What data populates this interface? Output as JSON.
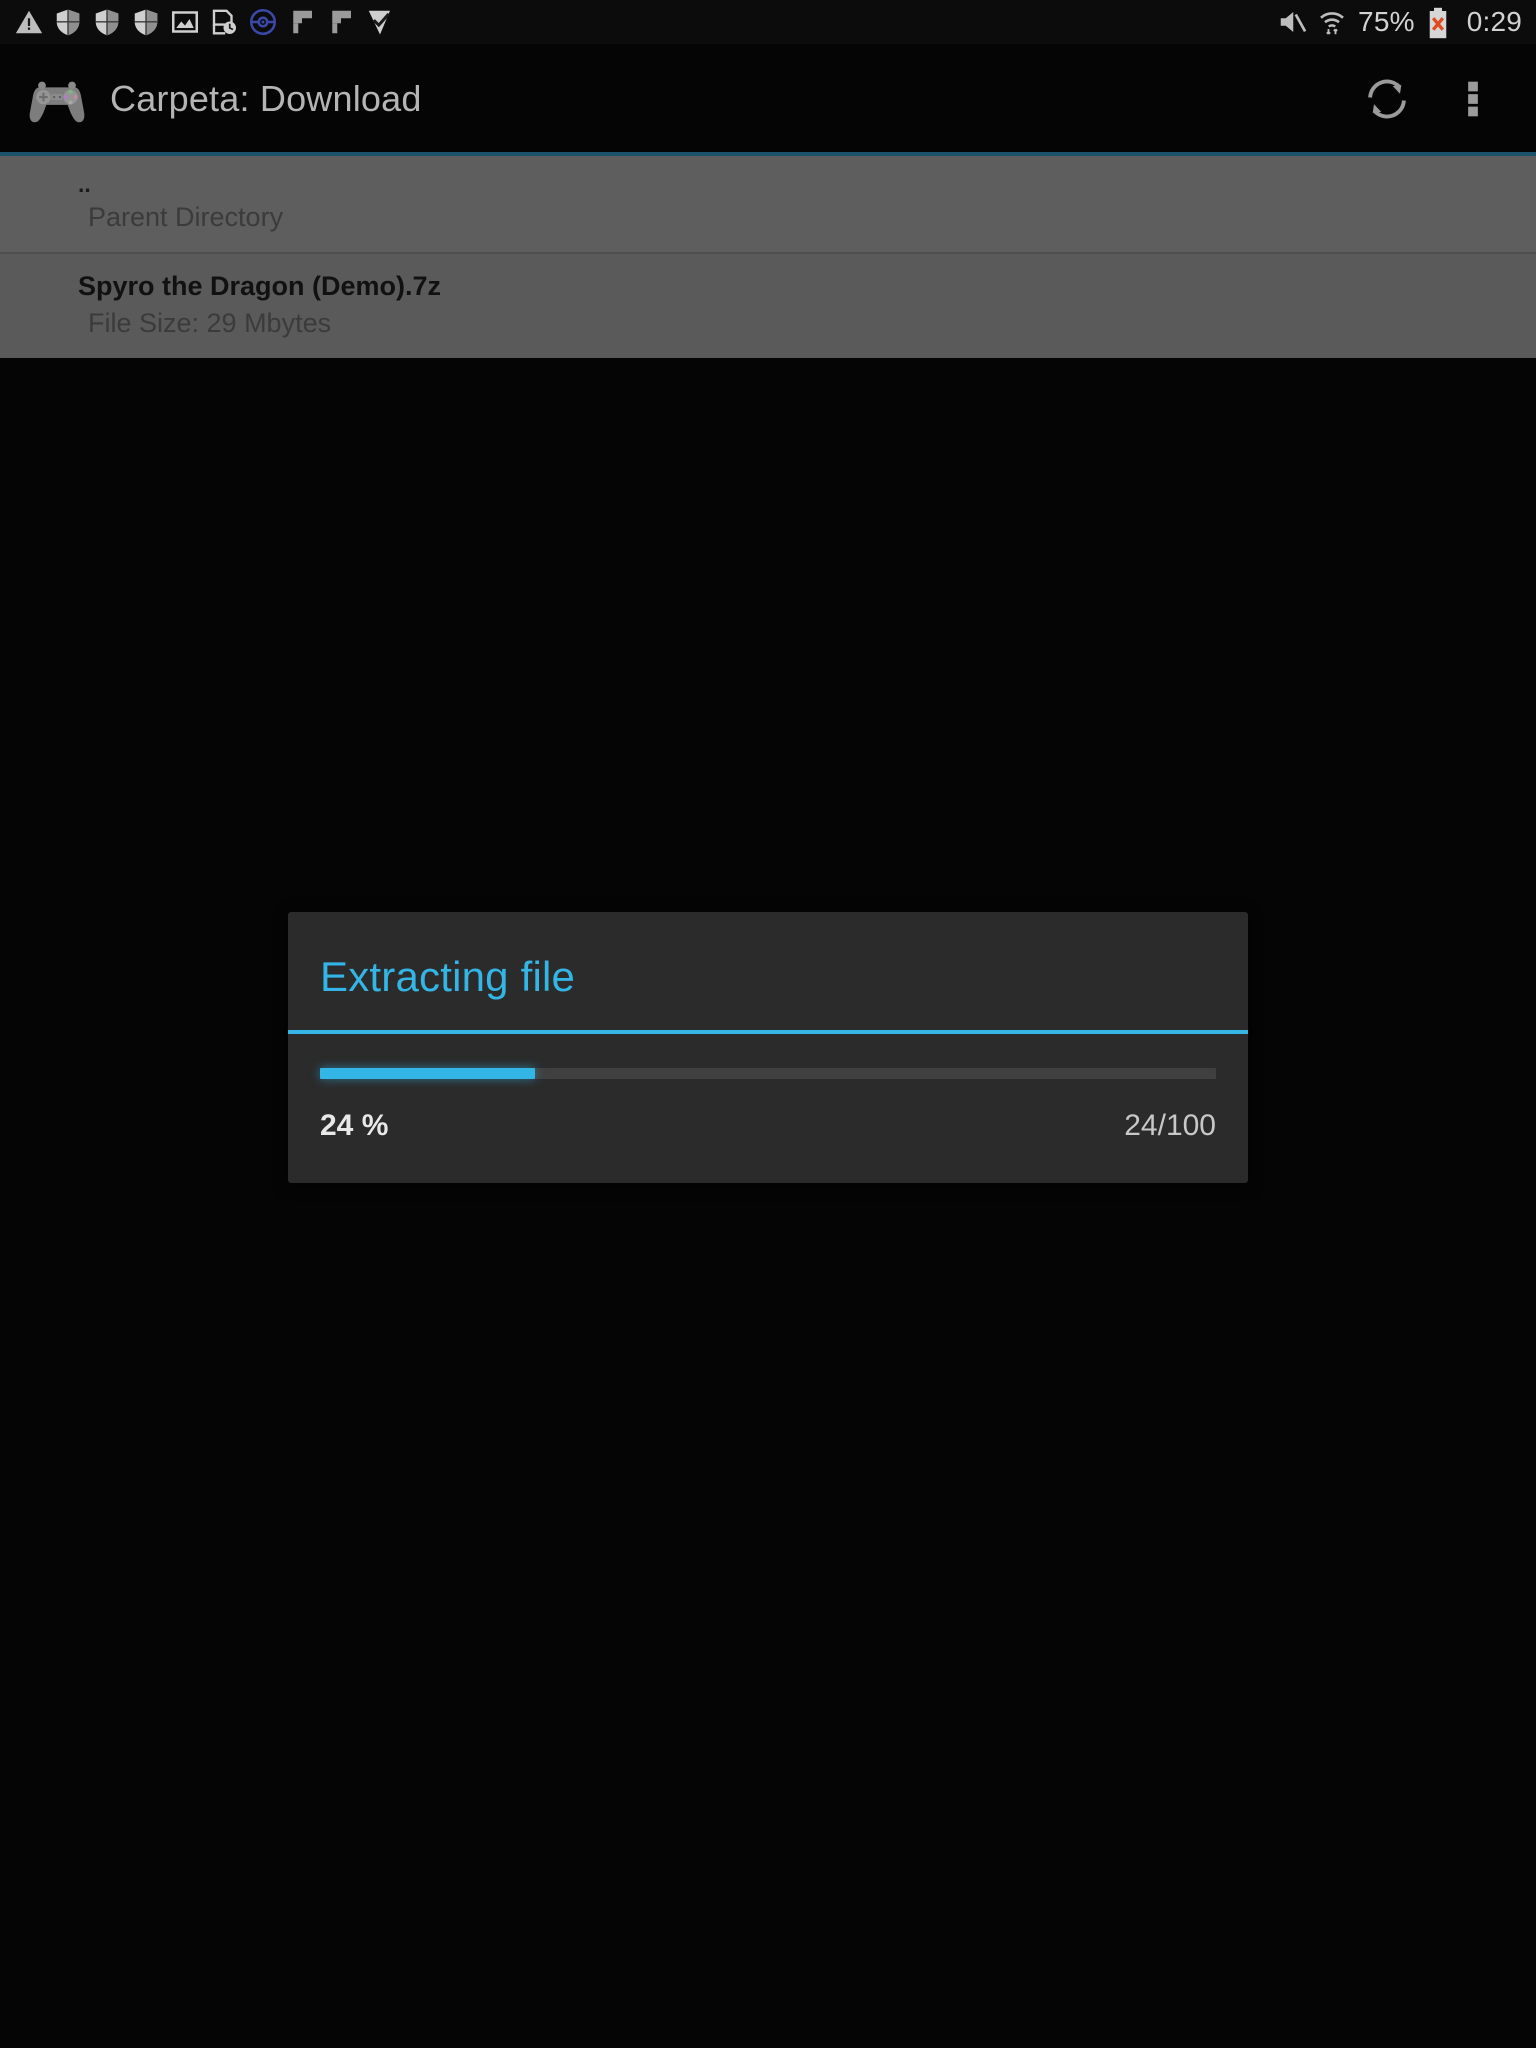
{
  "status_bar": {
    "notification_icons": [
      "warning-triangle-icon",
      "shield-icon-1",
      "shield-icon-2",
      "shield-icon-3",
      "photo-icon",
      "document-clock-icon",
      "pokeball-icon",
      "flag-icon-1",
      "flag-icon-2",
      "check-shield-icon"
    ],
    "mute_icon": "mute-icon",
    "wifi_icon": "wifi-icon",
    "battery_percent": "75%",
    "battery_icon": "battery-error-icon",
    "clock": "0:29"
  },
  "action_bar": {
    "app_icon": "gamepad-icon",
    "title": "Carpeta: Download",
    "refresh_label": "refresh-icon",
    "overflow_label": "overflow-menu-icon",
    "accent_underline_color": "#1d526b"
  },
  "file_list": {
    "rows": [
      {
        "title": "..",
        "subtitle": "Parent Directory"
      },
      {
        "title": "Spyro the Dragon (Demo).7z",
        "subtitle": "File Size: 29 Mbytes"
      }
    ]
  },
  "dialog": {
    "title": "Extracting file",
    "accent_color": "#33b5e5",
    "background_color": "#2b2b2b",
    "progress": {
      "percent_label": "24 %",
      "count_label": "24/100",
      "value": 24,
      "max": 100
    }
  }
}
